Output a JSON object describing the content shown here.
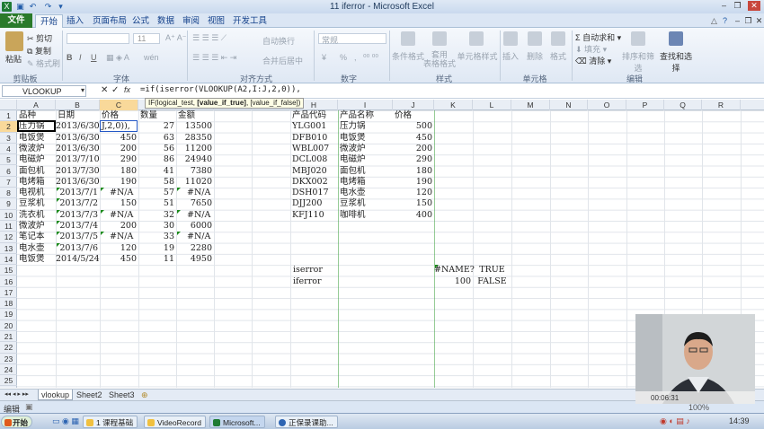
{
  "window": {
    "title": "11 iferror - Microsoft Excel"
  },
  "ribbon": {
    "tabs": [
      "文件",
      "开始",
      "插入",
      "页面布局",
      "公式",
      "数据",
      "审阅",
      "视图",
      "开发工具"
    ],
    "active_tab": "开始",
    "clipboard": {
      "paste": "粘贴",
      "cut": "剪切",
      "copy": "复制",
      "format_painter": "格式刷",
      "label": "剪贴板"
    },
    "font": {
      "size": "11",
      "bold": "B",
      "italic": "I",
      "underline": "U",
      "label": "字体"
    },
    "alignment": {
      "wrap": "自动换行",
      "merge": "合并后居中",
      "label": "对齐方式"
    },
    "number": {
      "format": "常规",
      "percent": "%",
      "comma": ",",
      "label": "数字"
    },
    "styles": {
      "conditional": "条件格式",
      "table_format": "套用\n表格格式",
      "cell_styles": "单元格样式",
      "label": "样式"
    },
    "cells": {
      "insert": "插入",
      "delete": "删除",
      "format": "格式",
      "label": "单元格"
    },
    "editing": {
      "autosum": "自动求和",
      "fill": "填充",
      "clear": "清除",
      "sort_filter": "排序和筛选",
      "find_select": "查找和选择",
      "label": "编辑"
    }
  },
  "formula_bar": {
    "name_box": "VLOOKUP",
    "formula": "=if(iserror(VLOOKUP(A2,I:J,2,0)),",
    "tooltip_prefix": "IF(logical_test, ",
    "tooltip_bold": "[value_if_true]",
    "tooltip_suffix": ", [value_if_false])"
  },
  "columns": [
    "A",
    "B",
    "C",
    "D",
    "E",
    "F",
    "G",
    "H",
    "I",
    "J",
    "K",
    "L",
    "M",
    "N",
    "O",
    "P",
    "Q",
    "R"
  ],
  "rows": [
    "1",
    "2",
    "3",
    "4",
    "5",
    "6",
    "7",
    "8",
    "9",
    "10",
    "11",
    "12",
    "13",
    "14",
    "15",
    "16",
    "17",
    "18",
    "19",
    "20",
    "21",
    "22",
    "23",
    "24",
    "25"
  ],
  "sheet": {
    "headers": {
      "a": "品种",
      "b": "日期",
      "c": "价格",
      "d": "数量",
      "e": "金额",
      "h": "产品代码",
      "i": "产品名称",
      "j": "价格"
    },
    "left_rows": [
      {
        "a": "压力锅",
        "b": "2013/6/30",
        "c": "J,2,0)),",
        "d": "27",
        "e": "13500"
      },
      {
        "a": "电饭煲",
        "b": "2013/6/30",
        "c": "450",
        "d": "63",
        "e": "28350"
      },
      {
        "a": "微波炉",
        "b": "2013/6/30",
        "c": "200",
        "d": "56",
        "e": "11200"
      },
      {
        "a": "电磁炉",
        "b": "2013/7/10",
        "c": "290",
        "d": "86",
        "e": "24940"
      },
      {
        "a": "面包机",
        "b": "2013/7/30",
        "c": "180",
        "d": "41",
        "e": "7380"
      },
      {
        "a": "电烤箱",
        "b": "2013/6/30",
        "c": "190",
        "d": "58",
        "e": "11020"
      },
      {
        "a": "电视机",
        "b": "2013/7/1",
        "c": "#N/A",
        "d": "57",
        "e": "#N/A"
      },
      {
        "a": "豆浆机",
        "b": "2013/7/2",
        "c": "150",
        "d": "51",
        "e": "7650"
      },
      {
        "a": "洗衣机",
        "b": "2013/7/3",
        "c": "#N/A",
        "d": "32",
        "e": "#N/A"
      },
      {
        "a": "微波炉",
        "b": "2013/7/4",
        "c": "200",
        "d": "30",
        "e": "6000"
      },
      {
        "a": "笔记本",
        "b": "2013/7/5",
        "c": "#N/A",
        "d": "33",
        "e": "#N/A"
      },
      {
        "a": "电水壶",
        "b": "2013/7/6",
        "c": "120",
        "d": "19",
        "e": "2280"
      },
      {
        "a": "电饭煲",
        "b": "2014/5/24",
        "c": "450",
        "d": "11",
        "e": "4950"
      }
    ],
    "lookup_rows": [
      {
        "h": "YLG001",
        "i": "压力锅",
        "j": "500"
      },
      {
        "h": "DFB010",
        "i": "电饭煲",
        "j": "450"
      },
      {
        "h": "WBL007",
        "i": "微波炉",
        "j": "200"
      },
      {
        "h": "DCL008",
        "i": "电磁炉",
        "j": "290"
      },
      {
        "h": "MBJ020",
        "i": "面包机",
        "j": "180"
      },
      {
        "h": "DKX002",
        "i": "电烤箱",
        "j": "190"
      },
      {
        "h": "DSH017",
        "i": "电水壶",
        "j": "120"
      },
      {
        "h": "DJJ200",
        "i": "豆浆机",
        "j": "150"
      },
      {
        "h": "KFJ110",
        "i": "咖啡机",
        "j": "400"
      }
    ],
    "iserror": {
      "label": "iserror",
      "k": "#NAME?",
      "l": "TRUE"
    },
    "iferror": {
      "label": "iferror",
      "k": "100",
      "l": "FALSE"
    }
  },
  "sheet_tabs": [
    "vlookup",
    "Sheet2",
    "Sheet3"
  ],
  "status": {
    "mode": "编辑",
    "zoom": "100%"
  },
  "taskbar": {
    "start": "开始",
    "items": [
      "1 课程基础",
      "VideoRecord",
      "Microsoft...",
      "正保录课助..."
    ],
    "clock": "14:39"
  },
  "webcam": {
    "timer": "00:06:31"
  }
}
